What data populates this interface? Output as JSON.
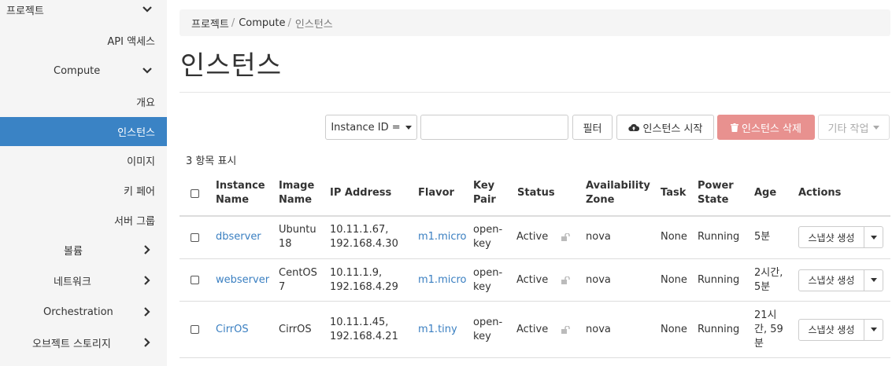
{
  "sidebar": {
    "items": [
      {
        "label": "프로젝트",
        "chevron": "down"
      },
      {
        "label": "API 액세스"
      },
      {
        "label": "Compute",
        "chevron": "down"
      },
      {
        "label": "개요"
      },
      {
        "label": "인스턴스",
        "active": true
      },
      {
        "label": "이미지"
      },
      {
        "label": "키 페어"
      },
      {
        "label": "서버 그룹"
      },
      {
        "label": "볼륨",
        "chevron": "right"
      },
      {
        "label": "네트워크",
        "chevron": "right"
      },
      {
        "label": "Orchestration",
        "chevron": "right"
      },
      {
        "label": "오브젝트 스토리지",
        "chevron": "right"
      }
    ],
    "active_color": "#3a83c5"
  },
  "breadcrumb": [
    "프로젝트",
    "Compute",
    "인스턴스"
  ],
  "page_title": "인스턴스",
  "toolbar": {
    "filter_field": "Instance ID =",
    "filter_input_value": "",
    "filter_label": "필터",
    "launch_label": "인스턴스 시작",
    "delete_label": "인스턴스 삭제",
    "more_label": "기타 작업",
    "launch_icon": "cloud-upload-icon",
    "delete_icon": "trash-icon"
  },
  "count_text": "3 항목 표시",
  "table": {
    "headers": [
      [
        "Instance",
        "Name"
      ],
      [
        "Image",
        "Name"
      ],
      [
        "IP Address"
      ],
      [
        "Flavor"
      ],
      [
        "Key",
        "Pair"
      ],
      [
        "Status"
      ],
      [
        "Availability",
        "Zone"
      ],
      [
        "Task"
      ],
      [
        "Power",
        "State"
      ],
      [
        "Age"
      ],
      [
        "Actions"
      ]
    ],
    "rows": [
      {
        "name": "dbserver",
        "image": [
          "Ubuntu",
          "18"
        ],
        "ip": [
          "10.11.1.67,",
          "192.168.4.30"
        ],
        "flavor": "m1.micro",
        "key": [
          "open-",
          "key"
        ],
        "status": "Active",
        "zone": "nova",
        "task": "None",
        "power": "Running",
        "age": [
          "5분"
        ],
        "action": "스냅샷 생성"
      },
      {
        "name": "webserver",
        "image": [
          "CentOS",
          "7"
        ],
        "ip": [
          "10.11.1.9,",
          "192.168.4.29"
        ],
        "flavor": "m1.micro",
        "key": [
          "open-",
          "key"
        ],
        "status": "Active",
        "zone": "nova",
        "task": "None",
        "power": "Running",
        "age": [
          "2시간,",
          "5분"
        ],
        "action": "스냅샷 생성"
      },
      {
        "name": "CirrOS",
        "image": [
          "CirrOS"
        ],
        "ip": [
          "10.11.1.45,",
          "192.168.4.21"
        ],
        "flavor": "m1.tiny",
        "key": [
          "open-",
          "key"
        ],
        "status": "Active",
        "zone": "nova",
        "task": "None",
        "power": "Running",
        "age": [
          "21시",
          "간, 59",
          "분"
        ],
        "action": "스냅샷 생성"
      }
    ]
  },
  "colors": {
    "link": "#3a7fc1",
    "danger": "#e8918f",
    "active": "#3a83c5"
  }
}
